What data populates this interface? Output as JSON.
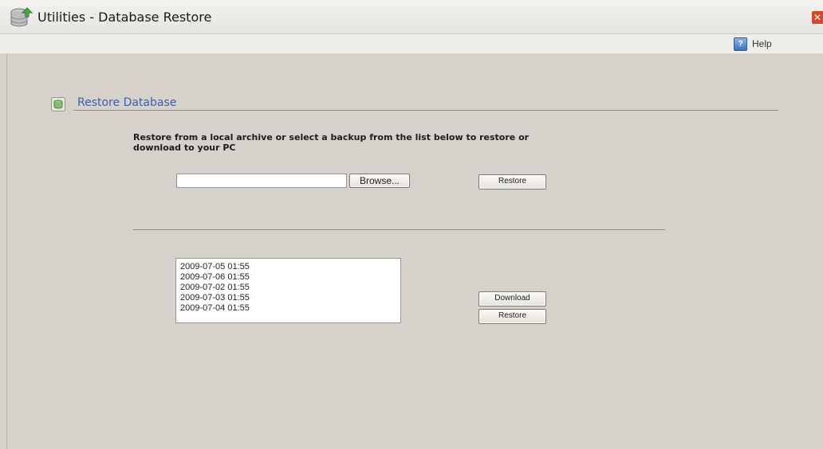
{
  "window": {
    "title": "Utilities - Database Restore",
    "close_glyph": "✕"
  },
  "toolbar": {
    "help_label": "Help",
    "help_icon": "help-icon"
  },
  "section": {
    "title": "Restore Database",
    "icon": "database-icon"
  },
  "instructions": "Restore from a local archive or select a backup from the list below to restore or download to your PC",
  "upload": {
    "file_value": "",
    "browse_label": "Browse...",
    "restore_label": "Restore"
  },
  "backups": {
    "items": [
      "2009-07-05 01:55",
      "2009-07-06 01:55",
      "2009-07-02 01:55",
      "2009-07-03 01:55",
      "2009-07-04 01:55"
    ],
    "download_label": "Download",
    "restore_label": "Restore"
  },
  "colors": {
    "accent": "#3a5fae",
    "background": "#d6d2cb",
    "close": "#d9472b"
  }
}
